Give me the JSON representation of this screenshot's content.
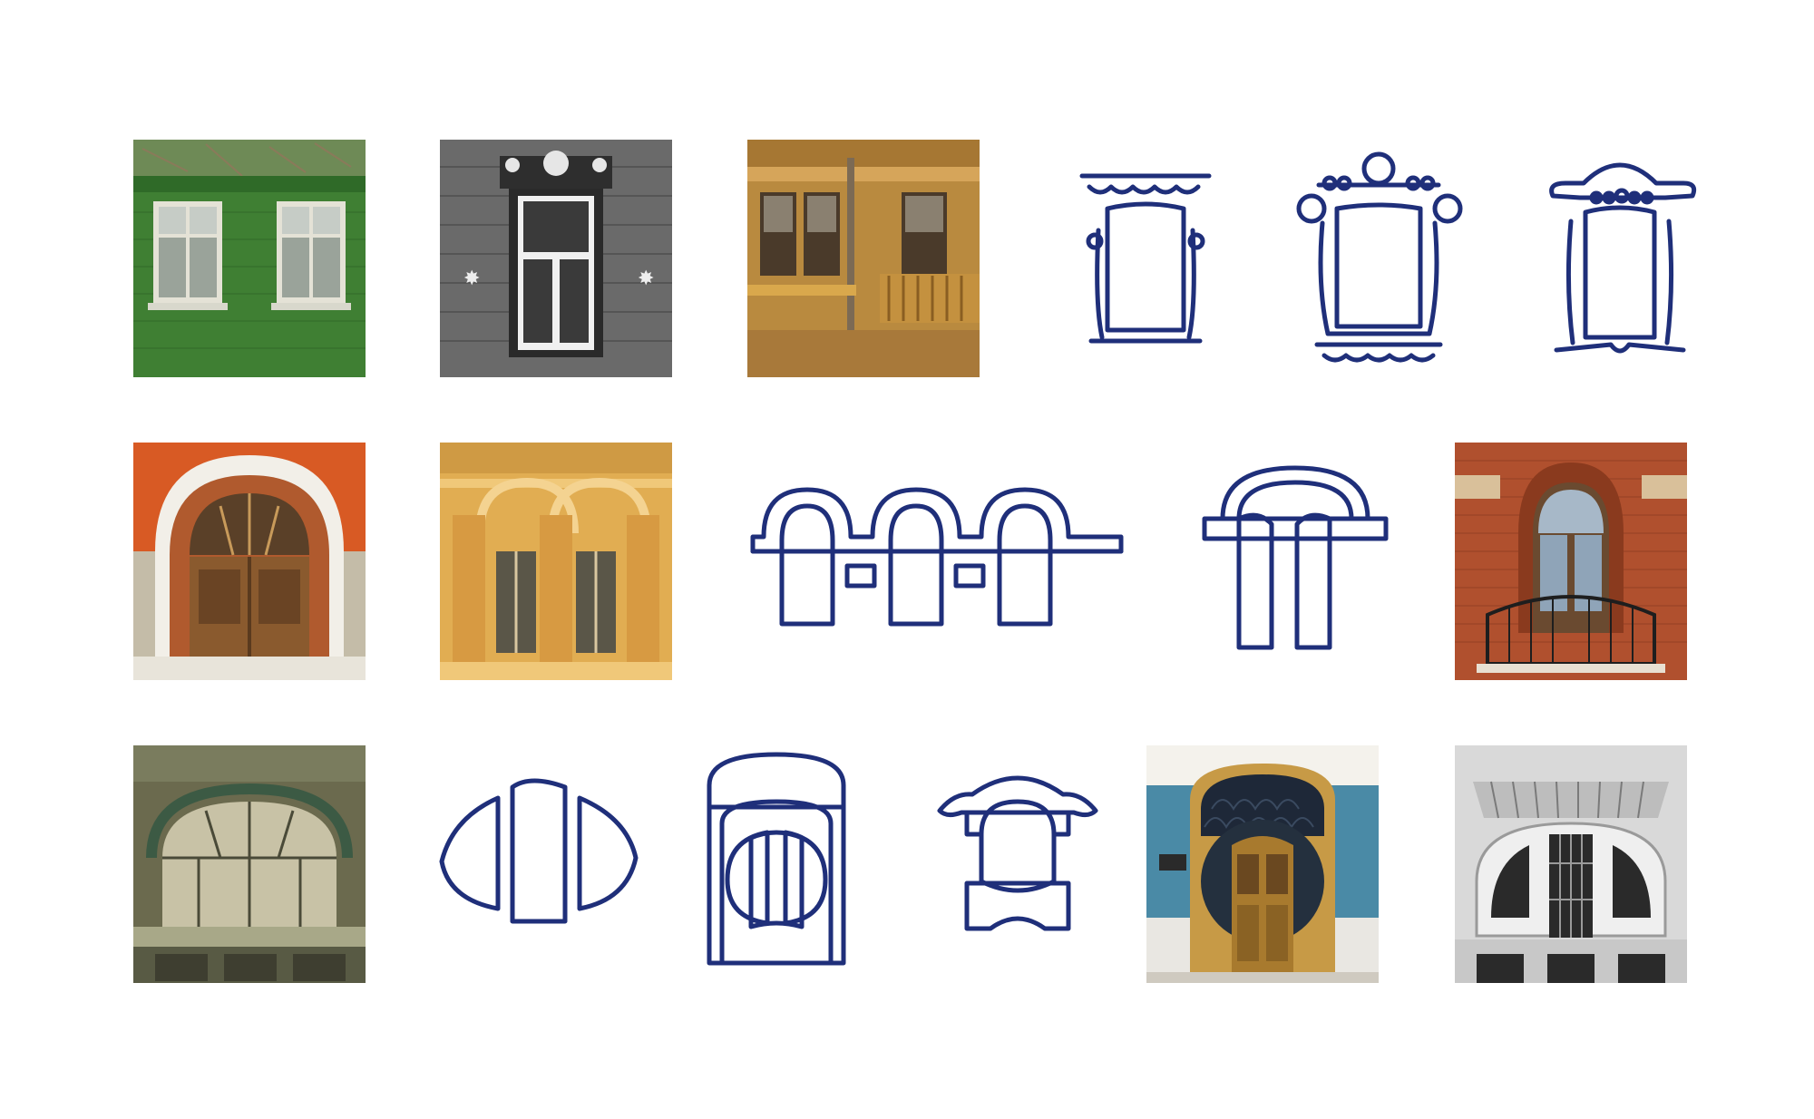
{
  "palette": {
    "icon_stroke": "#1f2f7a",
    "background": "#ffffff"
  },
  "tiles": [
    {
      "row": 1,
      "col": 1,
      "kind": "photo",
      "subject": "green-wooden-house-windows"
    },
    {
      "row": 1,
      "col": 2,
      "kind": "photo",
      "subject": "grayscale-carved-window-frame"
    },
    {
      "row": 1,
      "col": 3,
      "kind": "photo",
      "subject": "ochre-wooden-house-balcony"
    },
    {
      "row": 1,
      "col": 4,
      "kind": "icon",
      "subject": "carved-frame-window-icon"
    },
    {
      "row": 1,
      "col": 5,
      "kind": "icon",
      "subject": "ornate-round-frame-window-icon"
    },
    {
      "row": 1,
      "col": 6,
      "kind": "icon",
      "subject": "crowned-frame-window-icon"
    },
    {
      "row": 2,
      "col": 1,
      "kind": "photo",
      "subject": "arched-wooden-doorway"
    },
    {
      "row": 2,
      "col": 2,
      "kind": "photo",
      "subject": "yellow-facade-arched-windows"
    },
    {
      "row": 2,
      "col": 3,
      "kind": "icon",
      "subject": "triple-arch-window-icon"
    },
    {
      "row": 2,
      "col": 4,
      "kind": "icon",
      "subject": "single-arch-double-window-icon"
    },
    {
      "row": 2,
      "col": 5,
      "kind": "photo",
      "subject": "brick-window-balcony"
    },
    {
      "row": 3,
      "col": 1,
      "kind": "photo",
      "subject": "art-nouveau-arched-window"
    },
    {
      "row": 3,
      "col": 2,
      "kind": "icon",
      "subject": "segmented-window-icon"
    },
    {
      "row": 3,
      "col": 3,
      "kind": "icon",
      "subject": "round-door-frame-icon"
    },
    {
      "row": 3,
      "col": 4,
      "kind": "icon",
      "subject": "pagoda-roof-window-icon"
    },
    {
      "row": 3,
      "col": 5,
      "kind": "photo",
      "subject": "art-nouveau-round-door"
    },
    {
      "row": 3,
      "col": 6,
      "kind": "photo",
      "subject": "stone-facade-arched-window"
    }
  ]
}
